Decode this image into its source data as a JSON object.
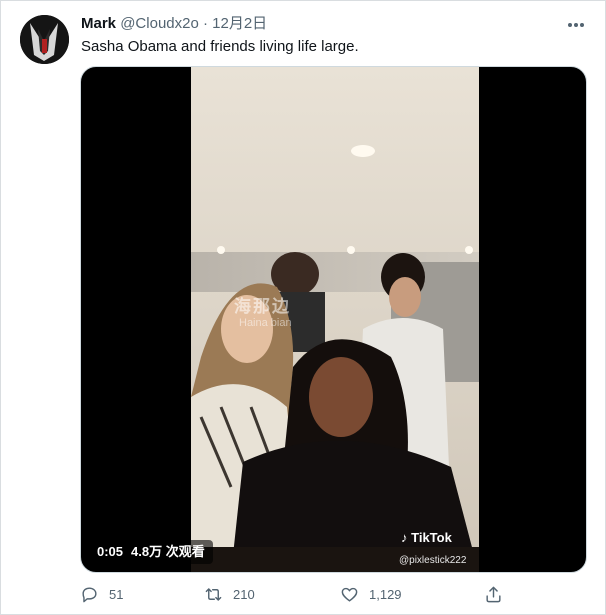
{
  "tweet": {
    "author_name": "Mark",
    "handle": "@Cloudx2o",
    "separator": "·",
    "date": "12月2日",
    "text": "Sasha Obama and friends living life large."
  },
  "media": {
    "time": "0:05",
    "views": "4.8万 次观看",
    "tiktok_label": "TikTok",
    "tiktok_user": "@pixlestick222",
    "watermark_main": "海那边",
    "watermark_sub": "Haina bian"
  },
  "actions": {
    "reply_count": "51",
    "retweet_count": "210",
    "like_count": "1,129"
  },
  "icons": [
    "avatar",
    "more-icon",
    "reply-icon",
    "retweet-icon",
    "like-icon",
    "share-icon",
    "tiktok-logo-icon"
  ],
  "colors": {
    "text_primary": "#0f1419",
    "text_secondary": "#536471",
    "border": "#cfd9de"
  }
}
